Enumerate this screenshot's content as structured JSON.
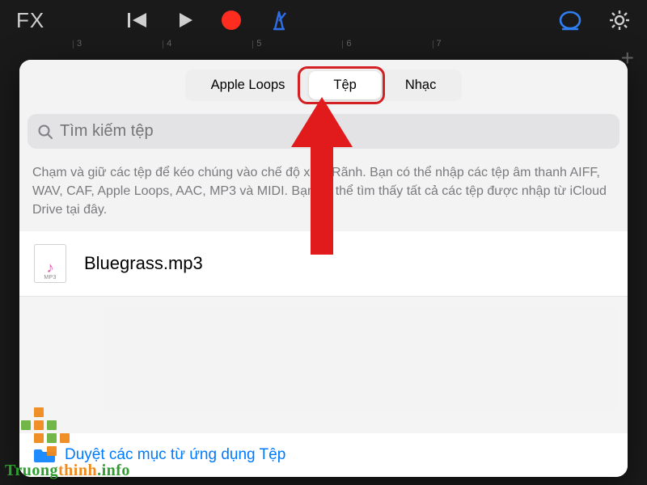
{
  "toolbar": {
    "fx_label": "FX",
    "ruler_ticks": [
      "3",
      "4",
      "5",
      "6",
      "7"
    ]
  },
  "popover": {
    "tabs": {
      "loops": "Apple Loops",
      "files": "Tệp",
      "music": "Nhạc",
      "active": "files"
    },
    "search": {
      "placeholder": "Tìm kiếm tệp"
    },
    "hint": "Chạm và giữ các tệp để kéo chúng vào chế độ xem Rãnh. Bạn có thể nhập các tệp âm thanh AIFF, WAV, CAF, Apple Loops, AAC, MP3 và MIDI. Bạn có thể tìm thấy tất cả các tệp được nhập từ iCloud Drive tại đây.",
    "files": [
      {
        "name": "Bluegrass.mp3",
        "ext": "MP3"
      }
    ],
    "browse_link": "Duyệt các mục từ ứng dụng Tệp"
  },
  "watermark": {
    "text_a": "Truong",
    "text_b": "thinh",
    "text_c": ".info"
  },
  "colors": {
    "accent_blue": "#007aff",
    "highlight_red": "#d32023"
  }
}
